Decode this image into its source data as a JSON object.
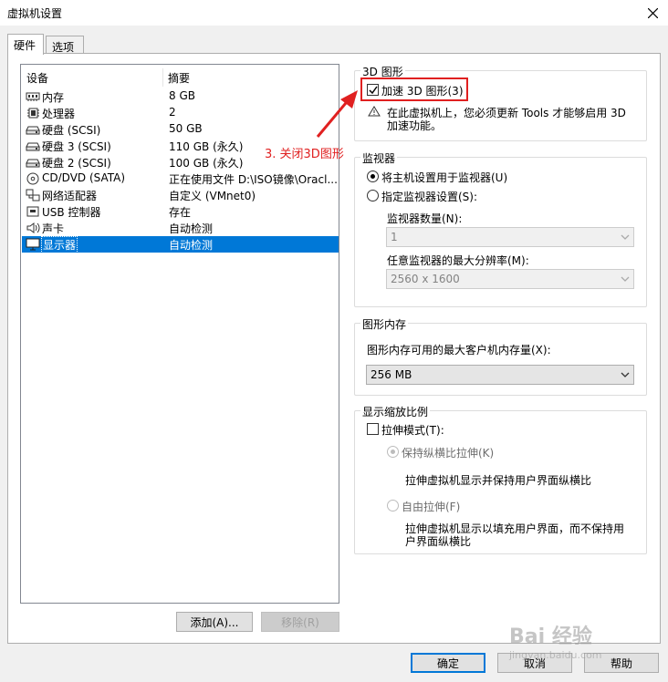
{
  "window": {
    "title": "虚拟机设置"
  },
  "tabs": [
    {
      "label": "硬件"
    },
    {
      "label": "选项"
    }
  ],
  "device_list": {
    "headers": {
      "device": "设备",
      "summary": "摘要"
    },
    "rows": [
      {
        "icon": "memory-icon",
        "name": "内存",
        "summary": "8 GB"
      },
      {
        "icon": "processor-icon",
        "name": "处理器",
        "summary": "2"
      },
      {
        "icon": "harddisk-icon",
        "name": "硬盘 (SCSI)",
        "summary": "50 GB"
      },
      {
        "icon": "harddisk-icon",
        "name": "硬盘 3 (SCSI)",
        "summary": "110 GB (永久)"
      },
      {
        "icon": "harddisk-icon",
        "name": "硬盘 2 (SCSI)",
        "summary": "100 GB (永久)"
      },
      {
        "icon": "cd-dvd-icon",
        "name": "CD/DVD (SATA)",
        "summary": "正在使用文件 D:\\ISO镜像\\Oracl..."
      },
      {
        "icon": "network-adapter-icon",
        "name": "网络适配器",
        "summary": "自定义 (VMnet0)"
      },
      {
        "icon": "usb-icon",
        "name": "USB 控制器",
        "summary": "存在"
      },
      {
        "icon": "sound-card-icon",
        "name": "声卡",
        "summary": "自动检测"
      },
      {
        "icon": "display-icon",
        "name": "显示器",
        "summary": "自动检测"
      }
    ],
    "selected_index": 9
  },
  "buttons": {
    "add": "添加(A)...",
    "remove": "移除(R)",
    "ok": "确定",
    "cancel": "取消",
    "help": "帮助"
  },
  "graphics_3d": {
    "legend": "3D 图形",
    "accelerate_label": "加速 3D 图形(3)",
    "accelerate_checked": true,
    "warning_line1": "在此虚拟机上，您必须更新 Tools 才能够启用 3D",
    "warning_line2": "加速功能。"
  },
  "monitors": {
    "legend": "监视器",
    "use_host_label": "将主机设置用于监视器(U)",
    "specify_label": "指定监视器设置(S):",
    "count_label": "监视器数量(N):",
    "count_value": "1",
    "max_res_label": "任意监视器的最大分辨率(M):",
    "max_res_value": "2560 x 1600"
  },
  "graphics_memory": {
    "legend": "图形内存",
    "max_label": "图形内存可用的最大客户机内存量(X):",
    "value": "256 MB"
  },
  "display_scaling": {
    "legend": "显示缩放比例",
    "stretch_label": "拉伸模式(T):",
    "keep_ratio_label": "保持纵横比拉伸(K)",
    "keep_ratio_desc": "拉伸虚拟机显示并保持用户界面纵横比",
    "free_label": "自由拉伸(F)",
    "free_desc_line1": "拉伸虚拟机显示以填充用户界面，而不保持用",
    "free_desc_line2": "户界面纵横比"
  },
  "annotation": {
    "text": "3. 关闭3D图形"
  },
  "watermark": {
    "main": "Bai 经验",
    "sub": "jingyan.baidu.com"
  }
}
